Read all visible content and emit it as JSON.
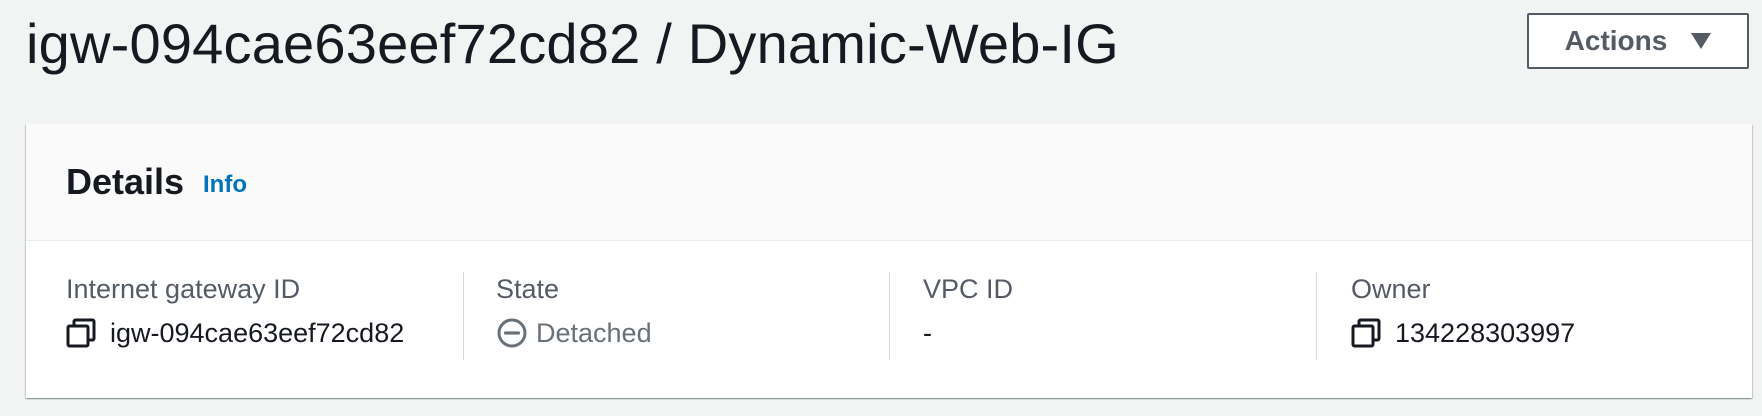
{
  "header": {
    "title": "igw-094cae63eef72cd82 / Dynamic-Web-IG",
    "actions_label": "Actions"
  },
  "details": {
    "title": "Details",
    "info_label": "Info",
    "fields": [
      {
        "label": "Internet gateway ID",
        "value": "igw-094cae63eef72cd82",
        "icon": "copy-icon"
      },
      {
        "label": "State",
        "value": "Detached",
        "icon": "minus-circle-icon"
      },
      {
        "label": "VPC ID",
        "value": "-"
      },
      {
        "label": "Owner",
        "value": "134228303997",
        "icon": "copy-icon"
      }
    ]
  },
  "colors": {
    "page_background": "#f2f3f3",
    "link": "#0073bb",
    "muted_text": "#687078",
    "label_text": "#545b64"
  }
}
